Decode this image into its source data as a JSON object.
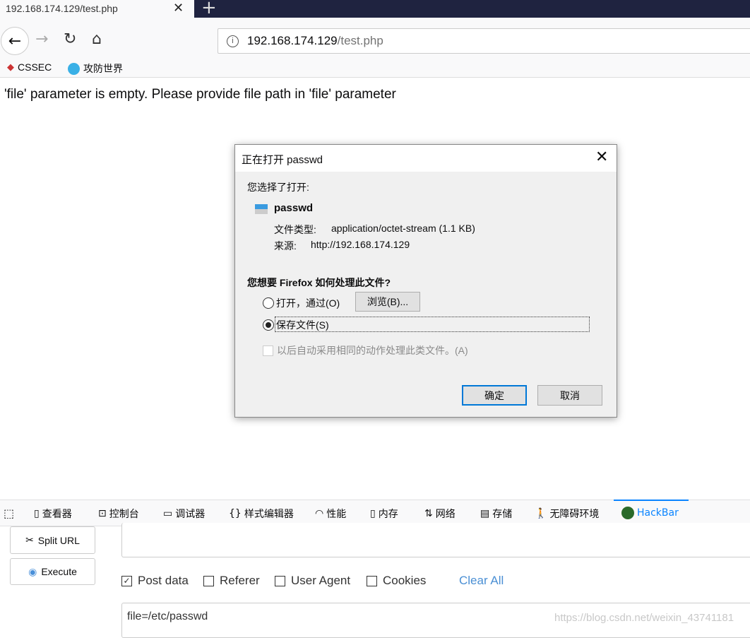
{
  "browser": {
    "tab_title": "192.168.174.129/test.php",
    "url_host": "192.168.174.129",
    "url_path": "/test.php",
    "bookmarks": [
      {
        "label": "CSSEC"
      },
      {
        "label": "攻防世界"
      }
    ]
  },
  "page": {
    "message": "'file' parameter is empty. Please provide file path in 'file' parameter"
  },
  "dialog": {
    "title": "正在打开 passwd",
    "intro": "您选择了打开:",
    "filename": "passwd",
    "type_label": "文件类型:",
    "type_value": "application/octet-stream (1.1 KB)",
    "source_label": "来源:",
    "source_value": "http://192.168.174.129",
    "question": "您想要 Firefox 如何处理此文件?",
    "open_with": "打开，通过(O)",
    "browse": "浏览(B)...",
    "save_file": "保存文件(S)",
    "selected": "save_file",
    "remember": "以后自动采用相同的动作处理此类文件。(A)",
    "ok": "确定",
    "cancel": "取消"
  },
  "devtools": {
    "tabs": [
      {
        "label": "查看器"
      },
      {
        "label": "控制台"
      },
      {
        "label": "调试器"
      },
      {
        "label": "样式编辑器"
      },
      {
        "label": "性能"
      },
      {
        "label": "内存"
      },
      {
        "label": "网络"
      },
      {
        "label": "存储"
      },
      {
        "label": "无障碍环境"
      },
      {
        "label": "HackBar"
      }
    ],
    "active": "HackBar",
    "accent": "#0a84ff"
  },
  "hackbar": {
    "split_url": "Split URL",
    "execute": "Execute",
    "url_value": "",
    "options": [
      {
        "label": "Post data",
        "checked": true
      },
      {
        "label": "Referer",
        "checked": false
      },
      {
        "label": "User Agent",
        "checked": false
      },
      {
        "label": "Cookies",
        "checked": false
      }
    ],
    "clear_all": "Clear All",
    "post_value": "file=/etc/passwd"
  },
  "watermark": "https://blog.csdn.net/weixin_43741181"
}
